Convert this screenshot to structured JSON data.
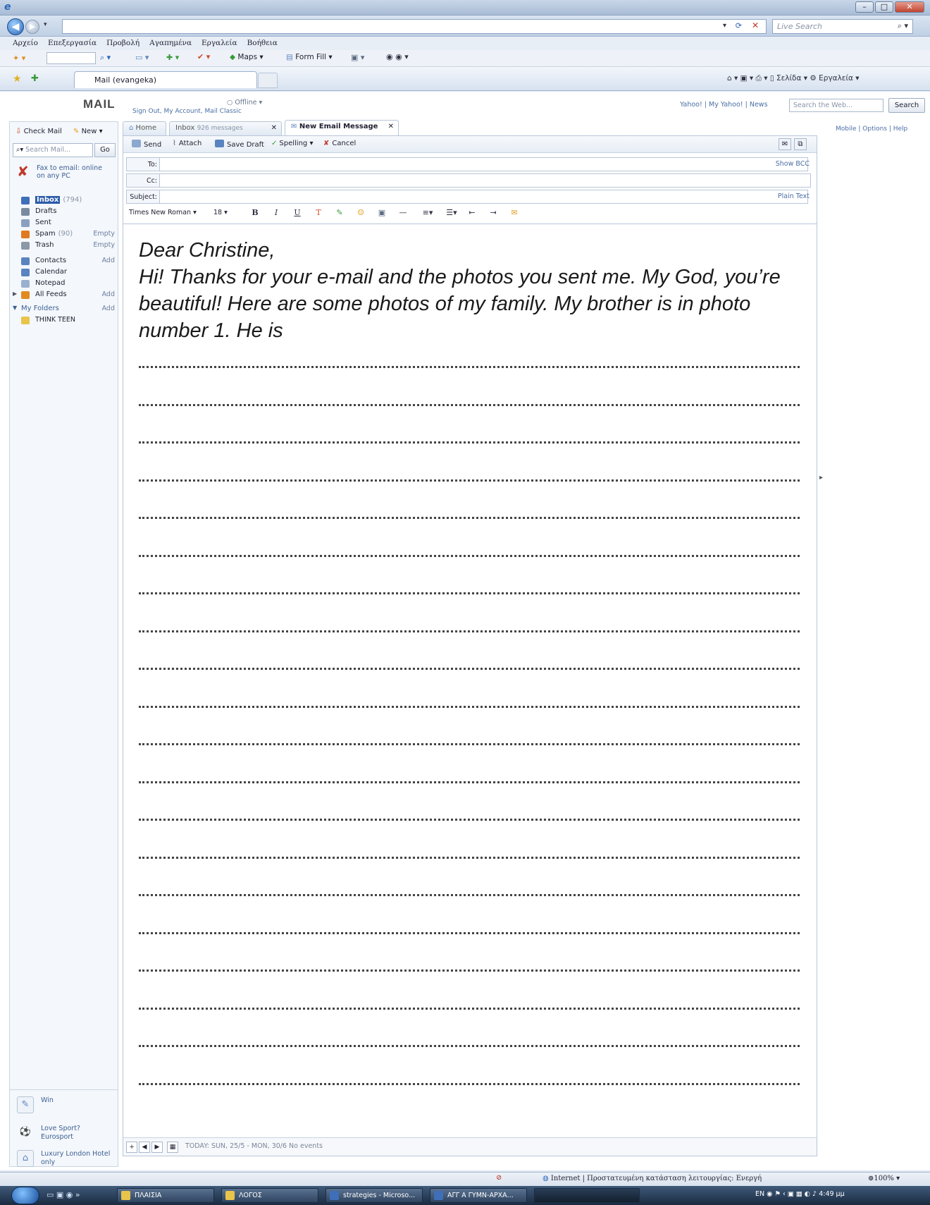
{
  "browser": {
    "search_placeholder": "Live Search",
    "menu": [
      "Αρχείο",
      "Επεξεργασία",
      "Προβολή",
      "Αγαπημένα",
      "Εργαλεία",
      "Βοήθεια"
    ],
    "toolbar": {
      "maps": "Maps",
      "form_fill": "Form Fill"
    },
    "tab_title": "Mail (evangeka)",
    "right_tools": {
      "page": "Σελίδα",
      "tools": "Εργαλεία"
    }
  },
  "header": {
    "logo": "MAIL",
    "links": "Sign Out, My Account, Mail Classic",
    "offline": "Offline",
    "top_links": "Yahoo! | My Yahoo! | News",
    "search_placeholder": "Search the Web...",
    "search_button": "Search",
    "right_links": "Mobile | Options | Help"
  },
  "sidebar": {
    "check_mail": "Check Mail",
    "new": "New",
    "search_placeholder": "Search Mail...",
    "go": "Go",
    "fax_promo": "Fax to email: online on any PC",
    "folders": [
      {
        "label": "Inbox",
        "count": "(794)",
        "action": "",
        "color": "#3f6fb8"
      },
      {
        "label": "Drafts",
        "count": "",
        "action": "",
        "color": "#7a8aa0"
      },
      {
        "label": "Sent",
        "count": "",
        "action": "",
        "color": "#8aa0c0"
      },
      {
        "label": "Spam",
        "count": "(90)",
        "action": "Empty",
        "color": "#e07a20"
      },
      {
        "label": "Trash",
        "count": "",
        "action": "Empty",
        "color": "#8a98a8"
      },
      {
        "label": "Contacts",
        "count": "",
        "action": "Add",
        "color": "#5a84c0"
      },
      {
        "label": "Calendar",
        "count": "",
        "action": "",
        "color": "#5a84c0"
      },
      {
        "label": "Notepad",
        "count": "",
        "action": "",
        "color": "#9ab0d0"
      },
      {
        "label": "All Feeds",
        "count": "",
        "action": "Add",
        "color": "#e08a20"
      },
      {
        "label": "My Folders",
        "count": "",
        "action": "Add",
        "color": ""
      },
      {
        "label": "THINK TEEN",
        "count": "",
        "action": "",
        "color": "#e8c44a"
      }
    ],
    "promos": [
      {
        "text": "Win",
        "icon": "pencil-icon"
      },
      {
        "text": "Love Sport? Eurosport",
        "icon": "soccer-ball-icon"
      },
      {
        "text": "Luxury London Hotel only",
        "icon": "hotel-icon"
      }
    ]
  },
  "tabs": {
    "home": "Home",
    "inbox": "Inbox",
    "inbox_count": "926 messages",
    "new_message": "New Email Message"
  },
  "compose": {
    "toolbar": {
      "send": "Send",
      "attach": "Attach",
      "save_draft": "Save Draft",
      "spelling": "Spelling",
      "cancel": "Cancel"
    },
    "to_label": "To:",
    "cc_label": "Cc:",
    "subject_label": "Subject:",
    "show_bcc": "Show BCC",
    "plain_text": "Plain Text",
    "font_name": "Times New Roman",
    "font_size": "18",
    "message": "Dear Christine,\nHi! Thanks for your e-mail and the photos you sent me. My God, you’re beautiful! Here are some photos of my family. My brother is in photo number 1. He is",
    "writing_lines": 20
  },
  "calendar_bar": {
    "text": "TODAY: SUN, 25/5 - MON, 30/6  No events"
  },
  "statusbar": {
    "zone": "Internet | Προστατευμένη κατάσταση λειτουργίας: Ενεργή",
    "zoom": "100%"
  },
  "taskbar": {
    "items": [
      "ΠΛΑΙΣΙΑ",
      "ΛΟΓΟΣ",
      "strategies - Microso...",
      "ΑΓΓ Α ΓΥΜΝ-ΑΡΧΑ..."
    ],
    "lang": "EN",
    "time": "4:49 μμ"
  }
}
